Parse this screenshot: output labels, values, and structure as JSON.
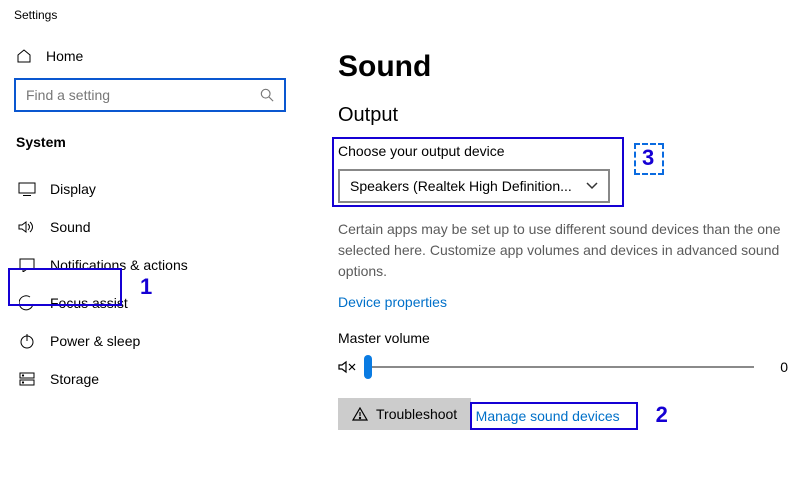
{
  "titlebar": {
    "title": "Settings"
  },
  "sidebar": {
    "home": "Home",
    "search_placeholder": "Find a setting",
    "section": "System",
    "items": [
      {
        "label": "Display"
      },
      {
        "label": "Sound"
      },
      {
        "label": "Notifications & actions"
      },
      {
        "label": "Focus assist"
      },
      {
        "label": "Power & sleep"
      },
      {
        "label": "Storage"
      }
    ]
  },
  "content": {
    "title": "Sound",
    "output_heading": "Output",
    "choose_label": "Choose your output device",
    "dropdown_value": "Speakers (Realtek High Definition...",
    "description": "Certain apps may be set up to use different sound devices than the one selected here. Customize app volumes and devices in advanced sound options.",
    "device_properties": "Device properties",
    "master_volume_label": "Master volume",
    "volume_value": "0",
    "troubleshoot": "Troubleshoot",
    "manage": "Manage sound devices"
  },
  "annotations": {
    "n1": "1",
    "n2": "2",
    "n3": "3"
  }
}
